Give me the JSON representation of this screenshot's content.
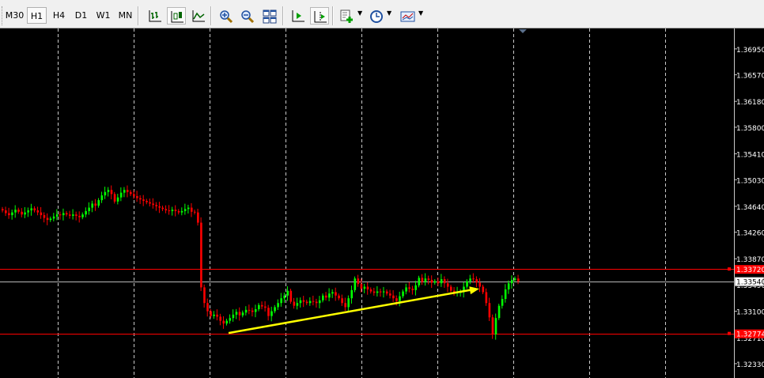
{
  "toolbar": {
    "timeframes": [
      {
        "label": "M30",
        "active": false
      },
      {
        "label": "H1",
        "active": true
      },
      {
        "label": "H4",
        "active": false
      },
      {
        "label": "D1",
        "active": false
      },
      {
        "label": "W1",
        "active": false
      },
      {
        "label": "MN",
        "active": false
      }
    ],
    "buttons": [
      {
        "name": "bar-chart-icon",
        "active": false
      },
      {
        "name": "candlestick-chart-icon",
        "active": true
      },
      {
        "name": "line-chart-icon",
        "active": false
      },
      {
        "name": "zoom-in-icon",
        "active": false
      },
      {
        "name": "zoom-out-icon",
        "active": false
      },
      {
        "name": "tile-windows-icon",
        "active": false
      },
      {
        "name": "auto-scroll-icon",
        "active": false
      },
      {
        "name": "chart-shift-icon",
        "active": true
      },
      {
        "name": "indicators-icon",
        "active": false
      },
      {
        "name": "periods-clock-icon",
        "active": false
      },
      {
        "name": "templates-icon",
        "active": false
      }
    ]
  },
  "chart_data": {
    "type": "candlestick",
    "y_ticks": [
      "1.36950",
      "1.36570",
      "1.36180",
      "1.35800",
      "1.35410",
      "1.35030",
      "1.34640",
      "1.34260",
      "1.33870",
      "1.33490",
      "1.33100",
      "1.32710",
      "1.32330"
    ],
    "ylim": [
      1.3212,
      1.3725
    ],
    "current_price": "1.33540",
    "levels": [
      {
        "label": "1.33720",
        "price": 1.3372,
        "color": "#ff0000"
      },
      {
        "label": "1.32774",
        "price": 1.32774,
        "color": "#ff0000"
      }
    ],
    "bull_color": "#00ff00",
    "bear_color": "#ff0000",
    "background": "#000000",
    "grid": "vertical dashed",
    "trendline": {
      "color": "#ffff00",
      "from": 1.3278,
      "to": 1.3343
    },
    "closes": [
      1.3458,
      1.3454,
      1.3451,
      1.3455,
      1.3459,
      1.3456,
      1.3452,
      1.3455,
      1.3458,
      1.3461,
      1.3458,
      1.3455,
      1.3451,
      1.3447,
      1.3444,
      1.3446,
      1.3449,
      1.3452,
      1.3451,
      1.3454,
      1.3452,
      1.345,
      1.3452,
      1.345,
      1.3448,
      1.3452,
      1.3457,
      1.3462,
      1.3468,
      1.3465,
      1.3473,
      1.348,
      1.3485,
      1.3488,
      1.3482,
      1.3471,
      1.3477,
      1.3484,
      1.3488,
      1.3485,
      1.3482,
      1.3479,
      1.3476,
      1.3474,
      1.3472,
      1.347,
      1.3468,
      1.3466,
      1.3464,
      1.3462,
      1.346,
      1.3458,
      1.3457,
      1.3459,
      1.3457,
      1.3455,
      1.3457,
      1.346,
      1.3462,
      1.3456,
      1.3455,
      1.344,
      1.3345,
      1.3322,
      1.331,
      1.3303,
      1.3305,
      1.3302,
      1.3296,
      1.3292,
      1.3296,
      1.33,
      1.3305,
      1.3309,
      1.3304,
      1.3308,
      1.3312,
      1.3311,
      1.3309,
      1.3313,
      1.3319,
      1.3317,
      1.3315,
      1.3303,
      1.331,
      1.3316,
      1.3322,
      1.3329,
      1.3333,
      1.334,
      1.3324,
      1.3318,
      1.3322,
      1.3326,
      1.3324,
      1.3322,
      1.3325,
      1.3324,
      1.3322,
      1.3326,
      1.3333,
      1.333,
      1.3336,
      1.3338,
      1.3333,
      1.3329,
      1.3322,
      1.3316,
      1.3329,
      1.3341,
      1.3358,
      1.335,
      1.3343,
      1.3346,
      1.3342,
      1.3339,
      1.3337,
      1.3339,
      1.3338,
      1.3339,
      1.3336,
      1.3333,
      1.3329,
      1.3325,
      1.3332,
      1.3339,
      1.3345,
      1.3343,
      1.3341,
      1.3348,
      1.3359,
      1.3353,
      1.3358,
      1.3356,
      1.3352,
      1.3354,
      1.3351,
      1.3357,
      1.3351,
      1.3346,
      1.334,
      1.3337,
      1.3338,
      1.3338,
      1.3346,
      1.3354,
      1.3358,
      1.3357,
      1.3352,
      1.3346,
      1.3338,
      1.3322,
      1.3301,
      1.3276,
      1.33,
      1.3318,
      1.3328,
      1.3342,
      1.3351,
      1.3356,
      1.3358,
      1.3354
    ]
  }
}
